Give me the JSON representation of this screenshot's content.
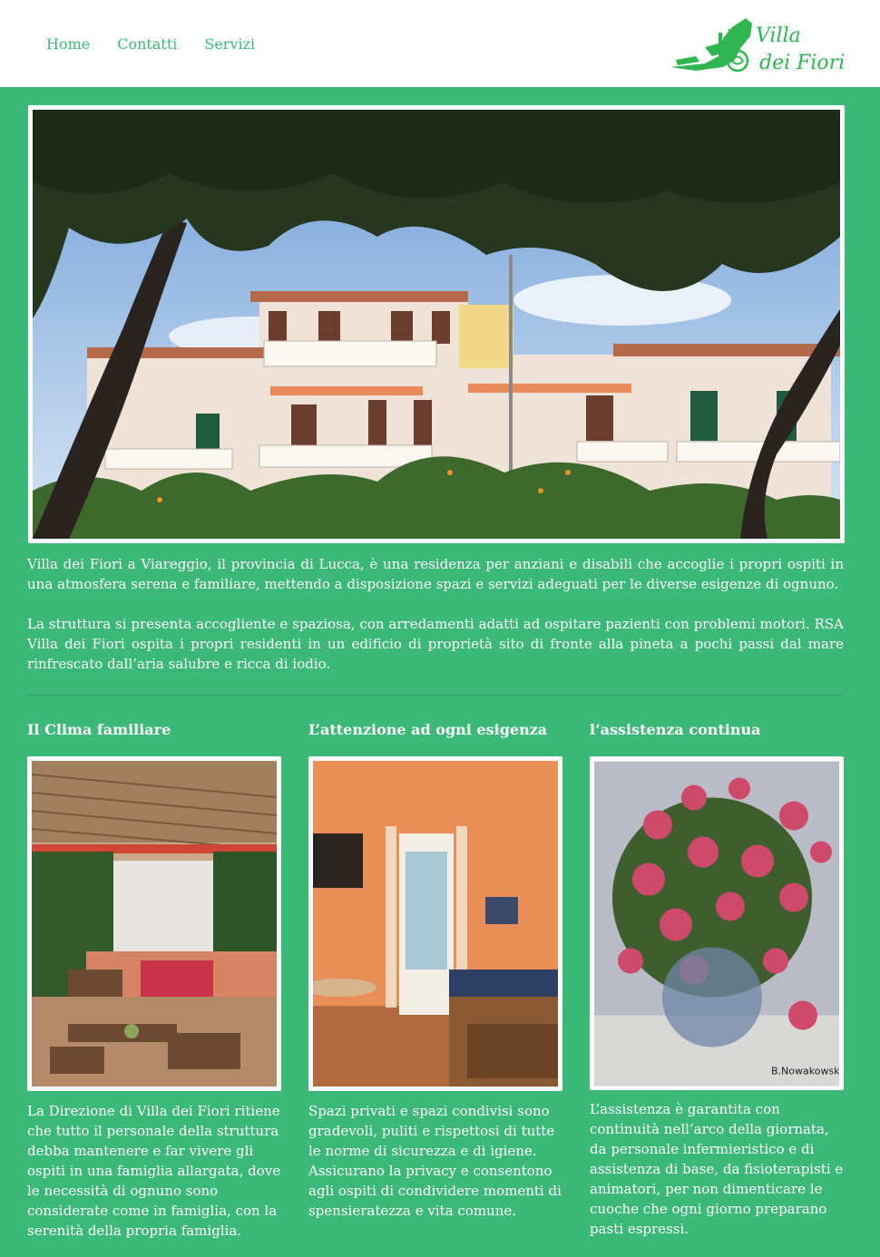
{
  "header": {
    "nav": [
      "Home",
      "Contatti",
      "Servizi"
    ],
    "logo_text_line1": "Villa",
    "logo_text_line2": "dei Fiori"
  },
  "intro": {
    "p1": "Villa dei Fiori a Viareggio, il provincia di Lucca, è una residenza per anziani e disabili che accoglie i propri ospiti in una atmosfera serena e familiare, mettendo a disposizione spazi e servizi adeguati per le diverse esigenze di ognuno.",
    "p2": "La struttura si presenta accogliente e spaziosa, con arredamenti adatti ad ospitare pazienti con problemi motori. RSA Villa dei Fiori ospita i propri residenti in un edificio di proprietà sito di fronte alla pineta a pochi passi dal mare rinfrescato dall’aria salubre e ricca di iodio."
  },
  "columns": [
    {
      "title": "Il Clima familiare",
      "text": "La Direzione di Villa dei Fiori ritiene che tutto il personale della struttura debba mantenere e far vivere gli ospiti in una famiglia allargata, dove le necessità di ognuno sono considerate come in famiglia, con la serenità della propria famiglia."
    },
    {
      "title": "L’attenzione ad ogni esigenza",
      "text": "Spazi privati e spazi condivisi sono gradevoli, puliti e rispettosi di tutte le norme di sicurezza e di igiene. Assicurano la privacy e consentono agli ospiti di condividere momenti di spensieratezza e vita comune."
    },
    {
      "title": "l’assistenza continua",
      "text": "L’assistenza è garantita con continuità nell’arco della giornata, da personale infermieristico e di assistenza di base, da fisioterapisti e animatori, per non dimenticare le cuoche che ogni giorno preparano pasti espressi."
    }
  ],
  "painting_signature": "B.Nowakowska",
  "colors": {
    "brand_green": "#3cb878",
    "white": "#ffffff"
  }
}
